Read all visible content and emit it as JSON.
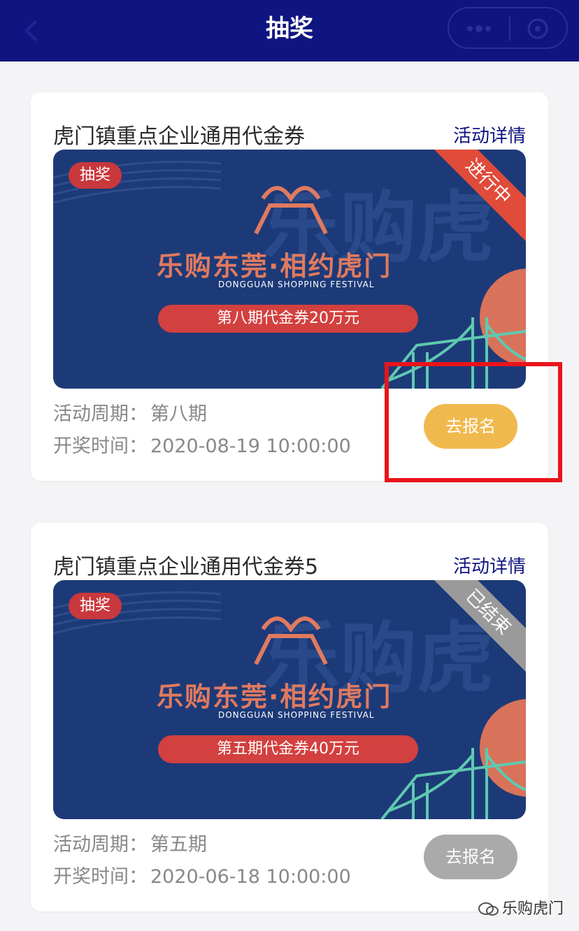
{
  "nav": {
    "title": "抽奖"
  },
  "cards": [
    {
      "title": "虎门镇重点企业通用代金券",
      "detail_link": "活动详情",
      "banner": {
        "tag": "抽奖",
        "status": "进行中",
        "brand_cn": "乐购东莞·相约虎门",
        "brand_en": "DONGGUAN SHOPPING FESTIVAL",
        "voucher": "第八期代金券20万元"
      },
      "period_label": "活动周期：",
      "period_value": "第八期",
      "draw_label": "开奖时间：",
      "draw_value": "2020-08-19 10:00:00",
      "button": "去报名"
    },
    {
      "title": "虎门镇重点企业通用代金券5",
      "detail_link": "活动详情",
      "banner": {
        "tag": "抽奖",
        "status": "已结束",
        "brand_cn": "乐购东莞·相约虎门",
        "brand_en": "DONGGUAN SHOPPING FESTIVAL",
        "voucher": "第五期代金券40万元"
      },
      "period_label": "活动周期：",
      "period_value": "第五期",
      "draw_label": "开奖时间：",
      "draw_value": "2020-06-18 10:00:00",
      "button": "去报名"
    }
  ],
  "watermark": "乐购虎门",
  "colors": {
    "nav": "#0f1580",
    "button_active": "#f0b94e",
    "button_inactive": "#aaaaaa",
    "highlight": "#e8141b"
  }
}
